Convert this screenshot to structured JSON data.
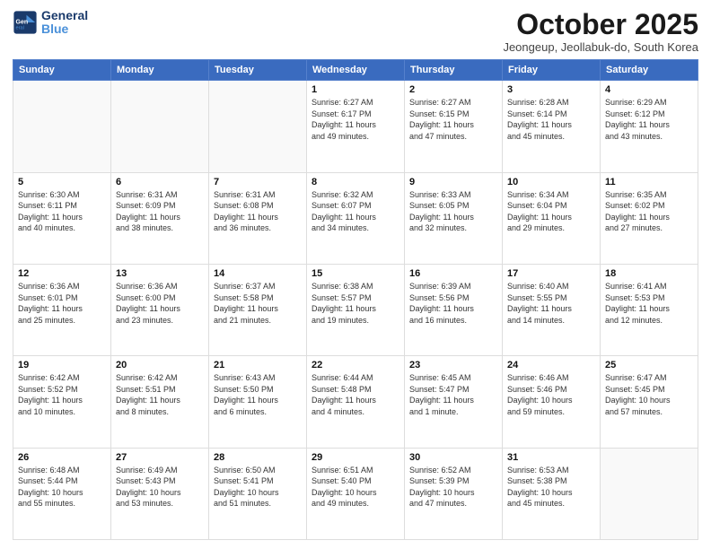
{
  "header": {
    "logo_line1": "General",
    "logo_line2": "Blue",
    "month_title": "October 2025",
    "location": "Jeongeup, Jeollabuk-do, South Korea"
  },
  "days_of_week": [
    "Sunday",
    "Monday",
    "Tuesday",
    "Wednesday",
    "Thursday",
    "Friday",
    "Saturday"
  ],
  "weeks": [
    [
      {
        "day": "",
        "info": ""
      },
      {
        "day": "",
        "info": ""
      },
      {
        "day": "",
        "info": ""
      },
      {
        "day": "1",
        "info": "Sunrise: 6:27 AM\nSunset: 6:17 PM\nDaylight: 11 hours\nand 49 minutes."
      },
      {
        "day": "2",
        "info": "Sunrise: 6:27 AM\nSunset: 6:15 PM\nDaylight: 11 hours\nand 47 minutes."
      },
      {
        "day": "3",
        "info": "Sunrise: 6:28 AM\nSunset: 6:14 PM\nDaylight: 11 hours\nand 45 minutes."
      },
      {
        "day": "4",
        "info": "Sunrise: 6:29 AM\nSunset: 6:12 PM\nDaylight: 11 hours\nand 43 minutes."
      }
    ],
    [
      {
        "day": "5",
        "info": "Sunrise: 6:30 AM\nSunset: 6:11 PM\nDaylight: 11 hours\nand 40 minutes."
      },
      {
        "day": "6",
        "info": "Sunrise: 6:31 AM\nSunset: 6:09 PM\nDaylight: 11 hours\nand 38 minutes."
      },
      {
        "day": "7",
        "info": "Sunrise: 6:31 AM\nSunset: 6:08 PM\nDaylight: 11 hours\nand 36 minutes."
      },
      {
        "day": "8",
        "info": "Sunrise: 6:32 AM\nSunset: 6:07 PM\nDaylight: 11 hours\nand 34 minutes."
      },
      {
        "day": "9",
        "info": "Sunrise: 6:33 AM\nSunset: 6:05 PM\nDaylight: 11 hours\nand 32 minutes."
      },
      {
        "day": "10",
        "info": "Sunrise: 6:34 AM\nSunset: 6:04 PM\nDaylight: 11 hours\nand 29 minutes."
      },
      {
        "day": "11",
        "info": "Sunrise: 6:35 AM\nSunset: 6:02 PM\nDaylight: 11 hours\nand 27 minutes."
      }
    ],
    [
      {
        "day": "12",
        "info": "Sunrise: 6:36 AM\nSunset: 6:01 PM\nDaylight: 11 hours\nand 25 minutes."
      },
      {
        "day": "13",
        "info": "Sunrise: 6:36 AM\nSunset: 6:00 PM\nDaylight: 11 hours\nand 23 minutes."
      },
      {
        "day": "14",
        "info": "Sunrise: 6:37 AM\nSunset: 5:58 PM\nDaylight: 11 hours\nand 21 minutes."
      },
      {
        "day": "15",
        "info": "Sunrise: 6:38 AM\nSunset: 5:57 PM\nDaylight: 11 hours\nand 19 minutes."
      },
      {
        "day": "16",
        "info": "Sunrise: 6:39 AM\nSunset: 5:56 PM\nDaylight: 11 hours\nand 16 minutes."
      },
      {
        "day": "17",
        "info": "Sunrise: 6:40 AM\nSunset: 5:55 PM\nDaylight: 11 hours\nand 14 minutes."
      },
      {
        "day": "18",
        "info": "Sunrise: 6:41 AM\nSunset: 5:53 PM\nDaylight: 11 hours\nand 12 minutes."
      }
    ],
    [
      {
        "day": "19",
        "info": "Sunrise: 6:42 AM\nSunset: 5:52 PM\nDaylight: 11 hours\nand 10 minutes."
      },
      {
        "day": "20",
        "info": "Sunrise: 6:42 AM\nSunset: 5:51 PM\nDaylight: 11 hours\nand 8 minutes."
      },
      {
        "day": "21",
        "info": "Sunrise: 6:43 AM\nSunset: 5:50 PM\nDaylight: 11 hours\nand 6 minutes."
      },
      {
        "day": "22",
        "info": "Sunrise: 6:44 AM\nSunset: 5:48 PM\nDaylight: 11 hours\nand 4 minutes."
      },
      {
        "day": "23",
        "info": "Sunrise: 6:45 AM\nSunset: 5:47 PM\nDaylight: 11 hours\nand 1 minute."
      },
      {
        "day": "24",
        "info": "Sunrise: 6:46 AM\nSunset: 5:46 PM\nDaylight: 10 hours\nand 59 minutes."
      },
      {
        "day": "25",
        "info": "Sunrise: 6:47 AM\nSunset: 5:45 PM\nDaylight: 10 hours\nand 57 minutes."
      }
    ],
    [
      {
        "day": "26",
        "info": "Sunrise: 6:48 AM\nSunset: 5:44 PM\nDaylight: 10 hours\nand 55 minutes."
      },
      {
        "day": "27",
        "info": "Sunrise: 6:49 AM\nSunset: 5:43 PM\nDaylight: 10 hours\nand 53 minutes."
      },
      {
        "day": "28",
        "info": "Sunrise: 6:50 AM\nSunset: 5:41 PM\nDaylight: 10 hours\nand 51 minutes."
      },
      {
        "day": "29",
        "info": "Sunrise: 6:51 AM\nSunset: 5:40 PM\nDaylight: 10 hours\nand 49 minutes."
      },
      {
        "day": "30",
        "info": "Sunrise: 6:52 AM\nSunset: 5:39 PM\nDaylight: 10 hours\nand 47 minutes."
      },
      {
        "day": "31",
        "info": "Sunrise: 6:53 AM\nSunset: 5:38 PM\nDaylight: 10 hours\nand 45 minutes."
      },
      {
        "day": "",
        "info": ""
      }
    ]
  ]
}
